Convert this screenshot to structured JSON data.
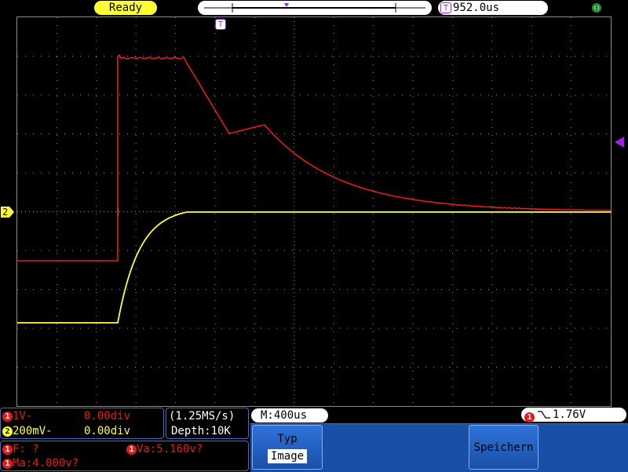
{
  "top_bar": {
    "status": "Ready",
    "trigger_time": "952.0us",
    "trigger_marker_glyph": "T"
  },
  "channels": {
    "ch1": {
      "number": "1",
      "scale": "1V-",
      "offset": "0.00div",
      "color": "#e31b1b"
    },
    "ch2": {
      "number": "2",
      "scale": "200mV-",
      "offset": "0.00div",
      "color": "#ffff33"
    }
  },
  "acquisition": {
    "sample_rate": "(1.25MS/s)",
    "depth": "Depth:10K",
    "timebase": "M:400us"
  },
  "measurements": {
    "frequency": "F:  ?",
    "va": "Va:5.160v?",
    "ma": "Ma:4.000v?"
  },
  "trigger": {
    "level": "1.76V"
  },
  "menu": {
    "type_title": "Typ",
    "type_value": "Image",
    "save_label": "Speichern"
  },
  "markers": {
    "ch2_marker": "2"
  },
  "colors": {
    "menu_blue": "#2f73d8",
    "panel_border": "#3a6fd0",
    "trigger_purple": "#a020f0",
    "grid": "#9a9a9a"
  }
}
